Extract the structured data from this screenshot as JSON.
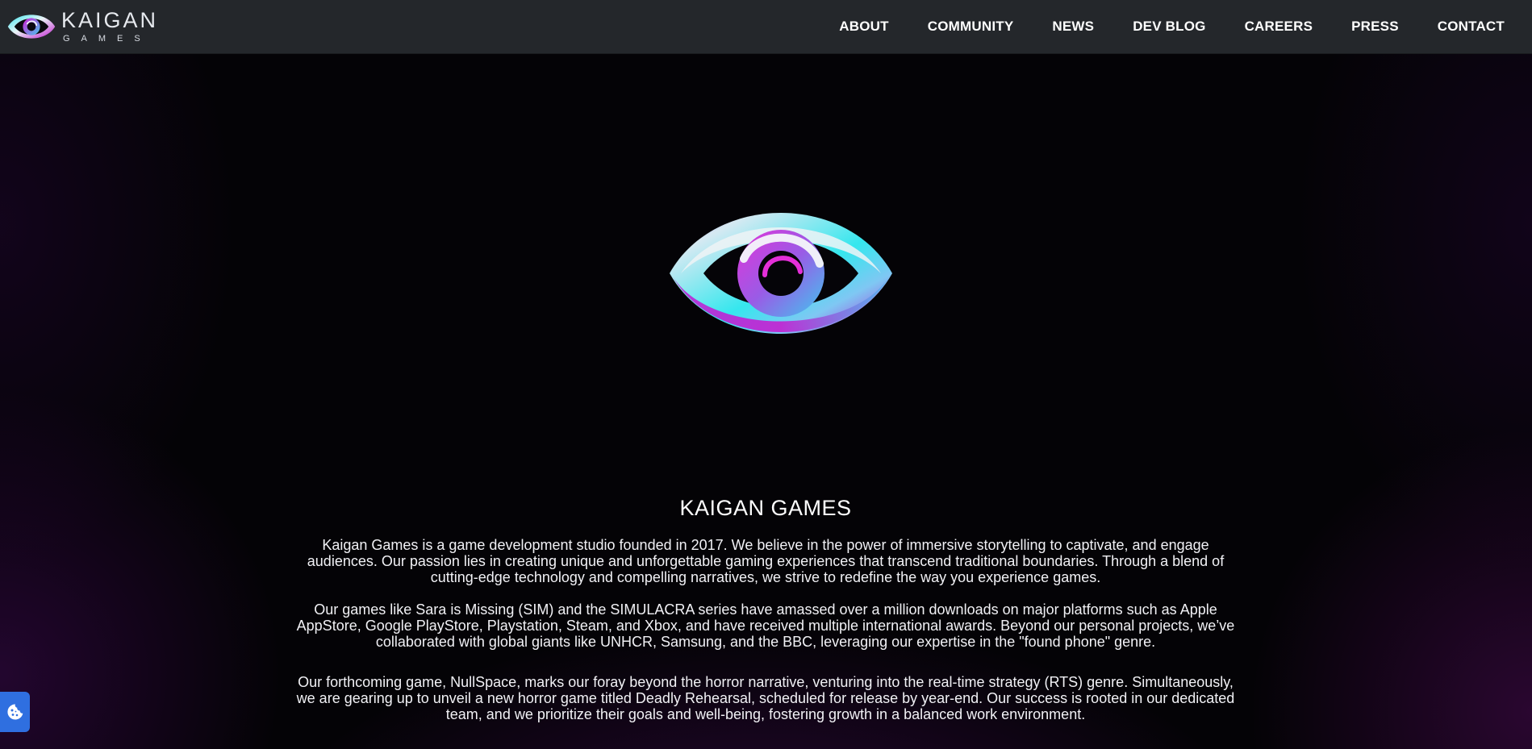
{
  "brand": {
    "name": "KAIGAN",
    "sub": "GAMES"
  },
  "nav": {
    "items": [
      {
        "label": "ABOUT"
      },
      {
        "label": "COMMUNITY"
      },
      {
        "label": "NEWS"
      },
      {
        "label": "DEV BLOG"
      },
      {
        "label": "CAREERS"
      },
      {
        "label": "PRESS"
      },
      {
        "label": "CONTACT"
      }
    ]
  },
  "hero": {
    "title": "KAIGAN GAMES",
    "paragraphs": [
      "Kaigan Games is a game development studio founded in 2017. We believe in the power of immersive storytelling to captivate, and engage audiences. Our passion lies in creating unique and unforgettable gaming experiences that transcend traditional boundaries. Through a blend of cutting-edge technology and compelling narratives, we strive to redefine the way you experience games.",
      "Our games like Sara is Missing (SIM) and the SIMULACRA series have amassed over a million downloads on major platforms such as Apple AppStore, Google PlayStore, Playstation, Steam, and Xbox, and have received multiple international awards. Beyond our personal projects, we’ve collaborated with global giants like UNHCR, Samsung, and the BBC, leveraging our expertise in the \"found phone\" genre.",
      "Our forthcoming game, NullSpace, marks our foray beyond the horror narrative, venturing into the real-time strategy (RTS) genre. Simultaneously, we are gearing up to unveil a new horror game titled Deadly Rehearsal, scheduled for release by year-end. Our success is rooted in our dedicated team, and we prioritize their goals and well-being, fostering growth in a balanced work environment."
    ]
  },
  "icons": {
    "logo": "eye-logo-icon",
    "hero": "eye-emblem-icon",
    "cookie": "cookie-icon"
  },
  "colors": {
    "topbar": "#24272b",
    "accent_cyan": "#38e6f0",
    "accent_magenta": "#c21bd0",
    "cookie_button": "#2f6fe0"
  }
}
